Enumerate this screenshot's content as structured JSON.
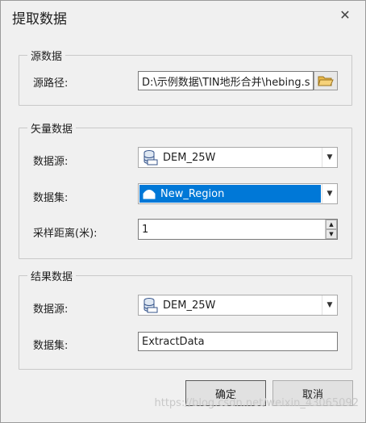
{
  "dialog": {
    "title": "提取数据",
    "close_glyph": "✕"
  },
  "source_group": {
    "legend": "源数据",
    "path_label": "源路径:",
    "path_value": "D:\\示例数据\\TIN地形合并\\hebing.s"
  },
  "vector_group": {
    "legend": "矢量数据",
    "datasource_label": "数据源:",
    "datasource_value": "DEM_25W",
    "dataset_label": "数据集:",
    "dataset_value": "New_Region",
    "sampling_label": "采样距离(米):",
    "sampling_value": "1"
  },
  "result_group": {
    "legend": "结果数据",
    "datasource_label": "数据源:",
    "datasource_value": "DEM_25W",
    "dataset_label": "数据集:",
    "dataset_value": "ExtractData"
  },
  "buttons": {
    "ok": "确定",
    "cancel": "取消"
  },
  "watermark": "https://blog.csdn.net/weixin_43065092",
  "icons": {
    "folder": "folder-open-icon",
    "datasource": "database-udb-icon",
    "dataset": "region-dataset-icon"
  },
  "colors": {
    "selection": "#0078d7",
    "background": "#f0f0f0"
  }
}
